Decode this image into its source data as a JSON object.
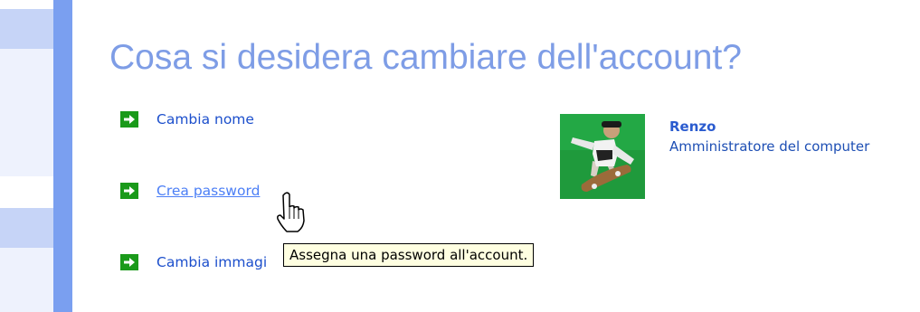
{
  "heading": "Cosa si desidera cambiare dell'account?",
  "tasks": [
    {
      "label": "Cambia nome",
      "icon": "green-arrow-icon"
    },
    {
      "label": "Crea password",
      "icon": "green-arrow-icon"
    },
    {
      "label": "Cambia immagi",
      "icon": "green-arrow-icon"
    }
  ],
  "account": {
    "name": "Renzo",
    "role": "Amministratore del computer",
    "avatar_icon": "skateboarder-picture"
  },
  "tooltip": {
    "text": "Assegna una password all'account."
  },
  "cursor": {
    "icon": "hand-pointer-icon"
  },
  "colors": {
    "heading": "#7e9de6",
    "link": "#1c4fcc",
    "link_hover": "#4c7ff6",
    "arrow_green": "#1a9a1a",
    "tooltip_bg": "#ffffe1",
    "task_pane_strip": "#7a9ff0"
  }
}
